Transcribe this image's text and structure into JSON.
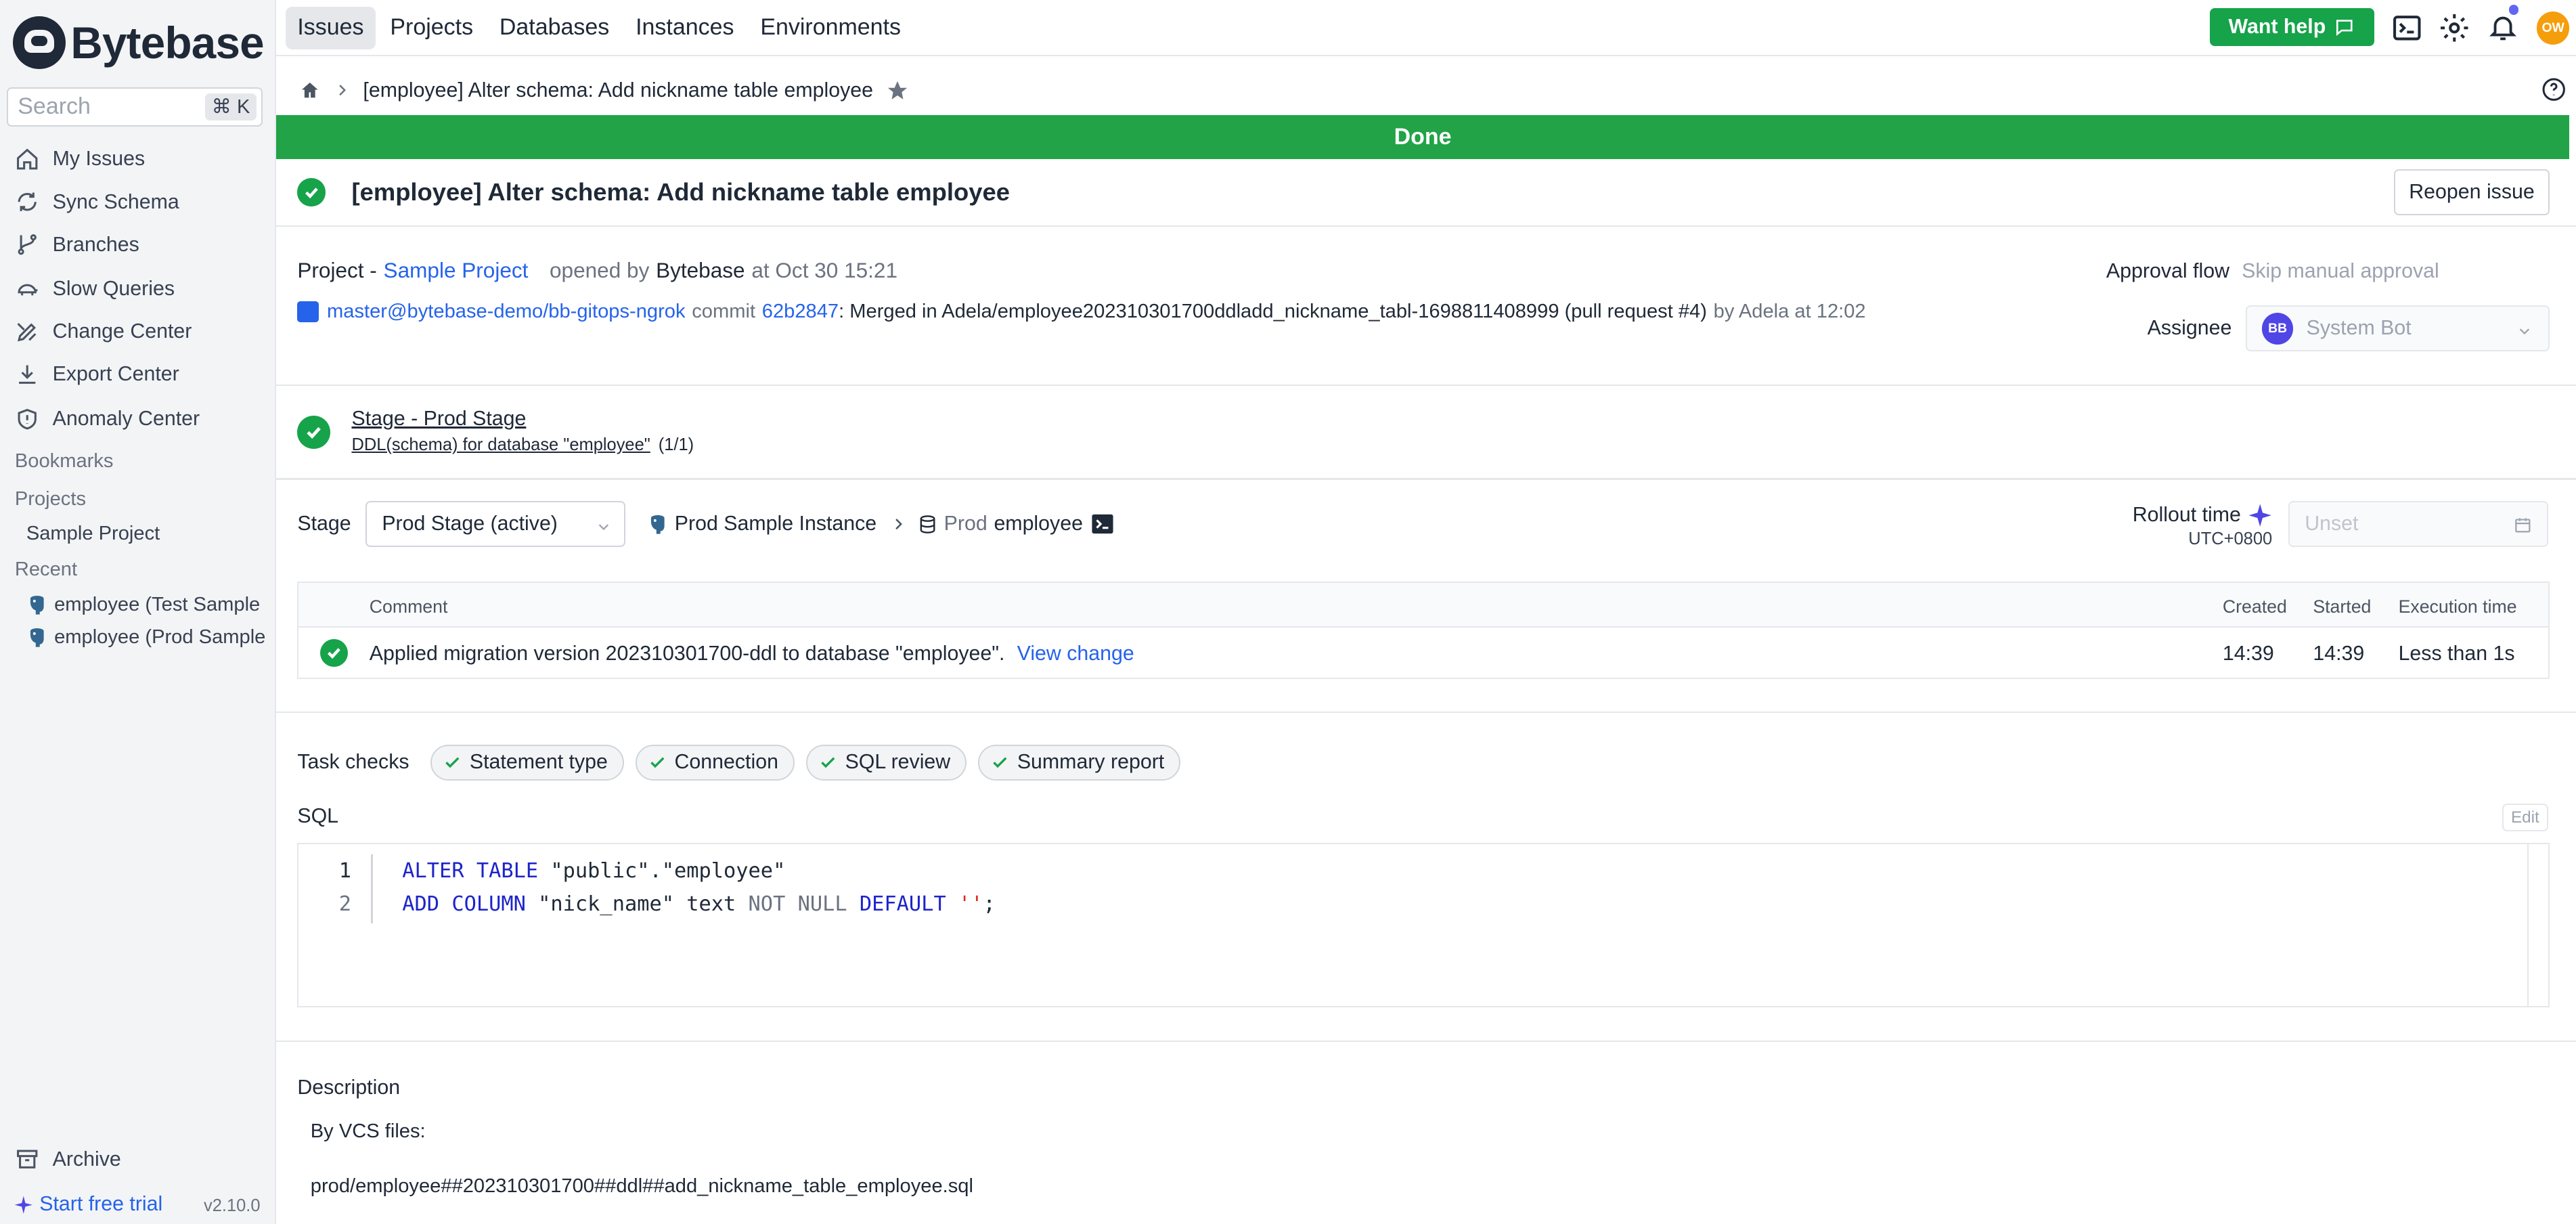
{
  "app": {
    "name": "Bytebase",
    "version": "v2.10.0"
  },
  "search": {
    "placeholder": "Search",
    "shortcut": "⌘ K"
  },
  "sidebar": {
    "items": [
      {
        "label": "My Issues",
        "icon": "home-icon"
      },
      {
        "label": "Sync Schema",
        "icon": "refresh-icon"
      },
      {
        "label": "Branches",
        "icon": "branch-icon"
      },
      {
        "label": "Slow Queries",
        "icon": "turtle-icon"
      },
      {
        "label": "Change Center",
        "icon": "pencil-ruler-icon"
      },
      {
        "label": "Export Center",
        "icon": "download-icon"
      },
      {
        "label": "Anomaly Center",
        "icon": "shield-icon"
      }
    ],
    "bookmarks_label": "Bookmarks",
    "projects_label": "Projects",
    "projects": [
      "Sample Project"
    ],
    "recent_label": "Recent",
    "recent": [
      "employee (Test Sample Instance)",
      "employee (Prod Sample Instance)"
    ],
    "archive_label": "Archive",
    "trial_label": "Start free trial"
  },
  "topnav": {
    "items": [
      "Issues",
      "Projects",
      "Databases",
      "Instances",
      "Environments"
    ],
    "active": "Issues",
    "want_help": "Want help",
    "user_initials": "OW"
  },
  "breadcrumb": {
    "title": "[employee] Alter schema: Add nickname table employee"
  },
  "banner": {
    "status": "Done",
    "color": "#22a347"
  },
  "issue": {
    "title": "[employee] Alter schema: Add nickname table employee",
    "reopen_label": "Reopen issue",
    "project_label": "Project -",
    "project_name": "Sample Project",
    "opened_by_label": "opened by",
    "creator": "Bytebase",
    "created_at": "at Oct 30 15:21",
    "vcs_repo": "master@bytebase-demo/bb-gitops-ngrok",
    "commit_label": "commit",
    "commit_hash": "62b2847",
    "commit_message": ": Merged in Adela/employee202310301700ddladd_nickname_tabl-1698811408999 (pull request #4)",
    "commit_by": "by Adela at 12:02",
    "approval_flow_label": "Approval flow",
    "approval_flow_value": "Skip manual approval",
    "assignee_label": "Assignee",
    "assignee_initials": "BB",
    "assignee_name": "System Bot"
  },
  "stage": {
    "title": "Stage - Prod Stage",
    "subtitle": "DDL(schema) for database \"employee\"",
    "progress": "(1/1)",
    "row_label": "Stage",
    "selected": "Prod Stage (active)",
    "instance": "Prod Sample Instance",
    "env": "Prod",
    "database": "employee",
    "rollout_label": "Rollout time",
    "timezone": "UTC+0800",
    "rollout_placeholder": "Unset"
  },
  "task_table": {
    "headers": {
      "comment": "Comment",
      "created": "Created",
      "started": "Started",
      "execution": "Execution time"
    },
    "rows": [
      {
        "comment": "Applied migration version 202310301700-ddl to database \"employee\".",
        "link": "View change",
        "created": "14:39",
        "started": "14:39",
        "execution": "Less than 1s"
      }
    ]
  },
  "task_checks": {
    "label": "Task checks",
    "items": [
      "Statement type",
      "Connection",
      "SQL review",
      "Summary report"
    ]
  },
  "sql": {
    "label": "SQL",
    "edit_label": "Edit",
    "lines": [
      {
        "no": "1",
        "parts": [
          {
            "t": "ALTER TABLE",
            "c": "kw"
          },
          {
            "t": " \"public\".\"employee\"",
            "c": ""
          }
        ]
      },
      {
        "no": "2",
        "parts": [
          {
            "t": "ADD COLUMN",
            "c": "kw"
          },
          {
            "t": " \"nick_name\" text ",
            "c": ""
          },
          {
            "t": "NOT NULL",
            "c": "kw-soft"
          },
          {
            "t": " ",
            "c": ""
          },
          {
            "t": "DEFAULT",
            "c": "kw"
          },
          {
            "t": " ",
            "c": ""
          },
          {
            "t": "''",
            "c": "str"
          },
          {
            "t": ";",
            "c": ""
          }
        ]
      }
    ]
  },
  "description": {
    "label": "Description",
    "lines": [
      "By VCS files:",
      "prod/employee##202310301700##ddl##add_nickname_table_employee.sql"
    ]
  }
}
